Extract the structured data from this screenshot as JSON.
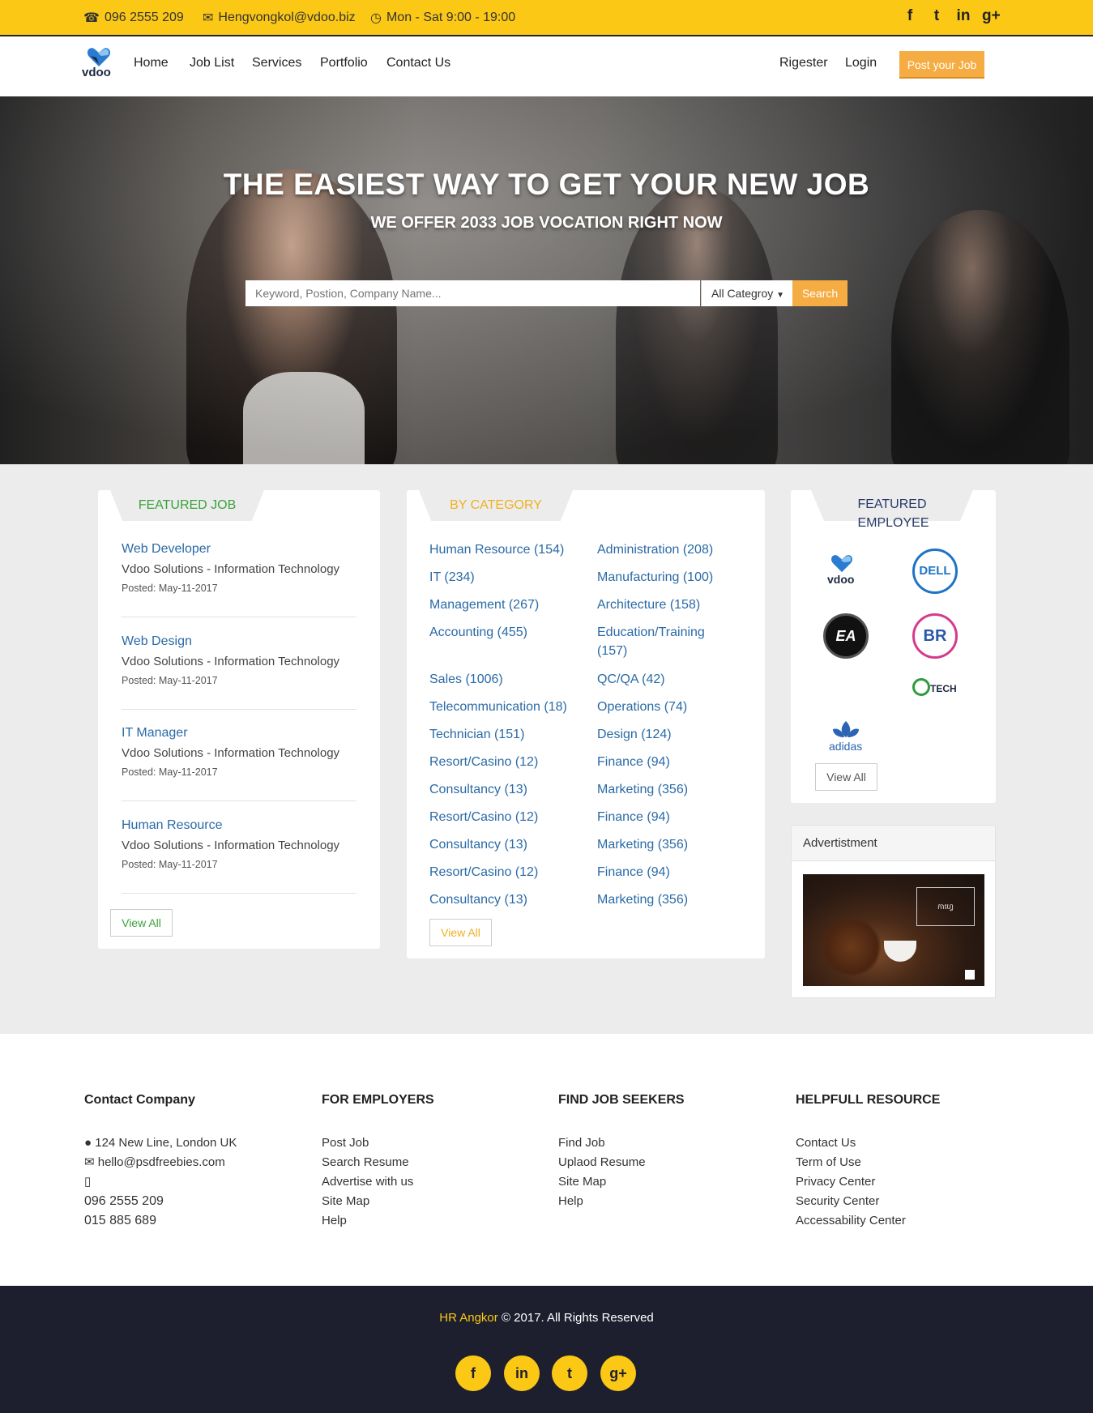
{
  "topbar": {
    "phone": "096 2555 209",
    "email": "Hengvongkol@vdoo.biz",
    "hours": "Mon - Sat 9:00 - 19:00",
    "social": [
      "f",
      "t",
      "in",
      "g+"
    ]
  },
  "nav": {
    "logo": "vdoo",
    "links": [
      "Home",
      "Job List",
      "Services",
      "Portfolio",
      "Contact Us"
    ],
    "register": "Rigester",
    "login": "Login",
    "post_job": "Post your Job"
  },
  "hero": {
    "title": "THE EASIEST WAY TO GET YOUR NEW JOB",
    "subtitle": "WE OFFER 2033 JOB VOCATION RIGHT NOW",
    "search_placeholder": "Keyword, Postion, Company Name...",
    "category_select": "All Categroy",
    "search_button": "Search"
  },
  "featured_job": {
    "title": "FEATURED JOB",
    "jobs": [
      {
        "title": "Web Developer",
        "company": "Vdoo Solutions - Information Technology",
        "posted": "Posted: May-11-2017"
      },
      {
        "title": "Web Design",
        "company": "Vdoo Solutions - Information Technology",
        "posted": "Posted: May-11-2017"
      },
      {
        "title": "IT Manager",
        "company": "Vdoo Solutions - Information Technology",
        "posted": "Posted: May-11-2017"
      },
      {
        "title": "Human Resource",
        "company": "Vdoo Solutions - Information Technology",
        "posted": "Posted: May-11-2017"
      }
    ],
    "view_all": "View All"
  },
  "by_category": {
    "title": "BY CATEGORY",
    "left": [
      "Human Resource (154)",
      "IT (234)",
      "Management (267)",
      "Accounting (455)",
      "Sales (1006)",
      "Telecommunication (18)",
      "Technician (151)",
      "Resort/Casino (12)",
      "Consultancy (13)",
      "Resort/Casino (12)",
      "Consultancy (13)",
      "Resort/Casino (12)",
      "Consultancy (13)"
    ],
    "right": [
      "Administration (208)",
      "Manufacturing (100)",
      "Architecture (158)",
      "Education/Training (157)",
      "QC/QA (42)",
      "Operations (74)",
      "Design (124)",
      "Finance (94)",
      "Marketing (356)",
      "Finance (94)",
      "Marketing (356)",
      "Finance (94)",
      "Marketing (356)"
    ],
    "view_all": "View All"
  },
  "featured_employee": {
    "title_line1": "FEATURED",
    "title_line2": "EMPLOYEE",
    "logos": [
      "vdoo",
      "DELL",
      "EA",
      "BR",
      "TECH",
      "adidas"
    ],
    "view_all": "View All"
  },
  "advertisement": {
    "title": "Advertistment",
    "ad_text": "កាហ្វេ"
  },
  "footer": {
    "contact": {
      "title": "Contact Company",
      "address": "124 New Line, London UK",
      "email": "hello@psdfreebies.com",
      "phone1": "096 2555 209",
      "phone2": "015 885 689"
    },
    "employers": {
      "title": "FOR EMPLOYERS",
      "links": [
        "Post Job",
        "Search Resume",
        "Advertise with us",
        "Site Map",
        "Help"
      ]
    },
    "seekers": {
      "title": "FIND JOB SEEKERS",
      "links": [
        "Find Job",
        "Uplaod Resume",
        "Site Map",
        "Help"
      ]
    },
    "resource": {
      "title": "HELPFULL RESOURCE",
      "links": [
        "Contact Us",
        "Term of Use",
        "Privacy Center",
        "Security Center",
        "Accessability Center"
      ]
    }
  },
  "bottom": {
    "brand": "HR Angkor",
    "copyright": " © 2017. All Rights Reserved",
    "social": [
      "f",
      "in",
      "t",
      "g+"
    ]
  },
  "colors": {
    "accent_yellow": "#fbc815",
    "accent_orange": "#f5ac42",
    "link_blue": "#2a6aa6",
    "featured_green": "#3aa23a",
    "employee_navy": "#263a68",
    "dark": "#1d1f2f"
  }
}
